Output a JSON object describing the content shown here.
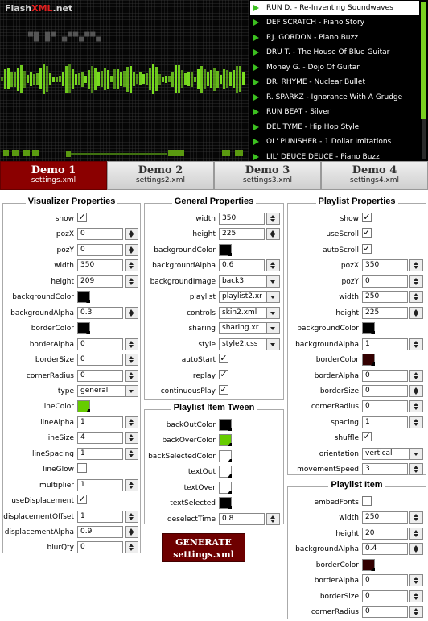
{
  "brand": {
    "part1": "Flash",
    "part2": "XML",
    "part3": ".net"
  },
  "player": {
    "ghost_text": "▀█ █▀ ▄▀▀▄▀▀▄",
    "accent": "#7be020",
    "highlight": "#3cc020"
  },
  "playlist": [
    {
      "label": "RUN D. - Re-Inventing Soundwaves",
      "selected": true
    },
    {
      "label": "DEF SCRATCH - Piano Story"
    },
    {
      "label": "P.J. GORDON - Piano Buzz"
    },
    {
      "label": "DRU T. - The House Of Blue Guitar"
    },
    {
      "label": "Money G. - Dojo Of Guitar"
    },
    {
      "label": "DR. RHYME - Nuclear Bullet"
    },
    {
      "label": "R. SPARKZ - Ignorance With A Grudge"
    },
    {
      "label": "RUN BEAT - Silver"
    },
    {
      "label": "DEL TYME - Hip Hop Style"
    },
    {
      "label": "OL' PUNISHER - 1 Dollar Imitations"
    },
    {
      "label": "LIL' DEUCE DEUCE - Piano Buzz"
    }
  ],
  "tabs": [
    {
      "title": "Demo 1",
      "file": "settings.xml",
      "active": true
    },
    {
      "title": "Demo 2",
      "file": "settings2.xml"
    },
    {
      "title": "Demo 3",
      "file": "settings3.xml"
    },
    {
      "title": "Demo 4",
      "file": "settings4.xml"
    }
  ],
  "visualizer": {
    "title": "Visualizer Properties",
    "rows": [
      {
        "label": "show",
        "type": "check",
        "checked": true
      },
      {
        "label": "pozX",
        "type": "num",
        "value": "0"
      },
      {
        "label": "pozY",
        "type": "num",
        "value": "0"
      },
      {
        "label": "width",
        "type": "num",
        "value": "350"
      },
      {
        "label": "height",
        "type": "num",
        "value": "209"
      },
      {
        "label": "backgroundColor",
        "type": "color",
        "color": "#000000"
      },
      {
        "label": "backgroundAlpha",
        "type": "num",
        "value": "0.3"
      },
      {
        "label": "borderColor",
        "type": "color",
        "color": "#000000"
      },
      {
        "label": "borderAlpha",
        "type": "num",
        "value": "0"
      },
      {
        "label": "borderSize",
        "type": "num",
        "value": "0"
      },
      {
        "label": "cornerRadius",
        "type": "num",
        "value": "0"
      },
      {
        "label": "type",
        "type": "select",
        "value": "general"
      },
      {
        "label": "lineColor",
        "type": "color",
        "color": "#66cc00"
      },
      {
        "label": "lineAlpha",
        "type": "num",
        "value": "1"
      },
      {
        "label": "lineSize",
        "type": "num",
        "value": "4"
      },
      {
        "label": "lineSpacing",
        "type": "num",
        "value": "1"
      },
      {
        "label": "lineGlow",
        "type": "check",
        "checked": false
      },
      {
        "label": "multiplier",
        "type": "num",
        "value": "1"
      },
      {
        "label": "useDisplacement",
        "type": "check",
        "checked": true
      },
      {
        "label": "displacementOffset",
        "type": "num",
        "value": "1"
      },
      {
        "label": "displacementAlpha",
        "type": "num",
        "value": "0.9"
      },
      {
        "label": "blurQty",
        "type": "num",
        "value": "0"
      }
    ]
  },
  "general": {
    "title": "General Properties",
    "rows": [
      {
        "label": "width",
        "type": "num",
        "value": "350"
      },
      {
        "label": "height",
        "type": "num",
        "value": "225"
      },
      {
        "label": "backgroundColor",
        "type": "color",
        "color": "#000000"
      },
      {
        "label": "backgroundAlpha",
        "type": "num",
        "value": "0.6"
      },
      {
        "label": "backgroundImage",
        "type": "select",
        "value": "back3"
      },
      {
        "label": "playlist",
        "type": "select",
        "value": "playlist2.xr"
      },
      {
        "label": "controls",
        "type": "select",
        "value": "skin2.xml"
      },
      {
        "label": "sharing",
        "type": "select",
        "value": "sharing.xr"
      },
      {
        "label": "style",
        "type": "select",
        "value": "style2.css"
      },
      {
        "label": "autoStart",
        "type": "check",
        "checked": true
      },
      {
        "label": "replay",
        "type": "check",
        "checked": true
      },
      {
        "label": "continuousPlay",
        "type": "check",
        "checked": true
      }
    ]
  },
  "tween": {
    "title": "Playlist Item Tween",
    "rows": [
      {
        "label": "backOutColor",
        "type": "color",
        "color": "#000000"
      },
      {
        "label": "backOverColor",
        "type": "color",
        "color": "#66cc00"
      },
      {
        "label": "backSelectedColor",
        "type": "color",
        "color": "#ffffff"
      },
      {
        "label": "textOut",
        "type": "color",
        "color": "#ffffff"
      },
      {
        "label": "textOver",
        "type": "color",
        "color": "#ffffff"
      },
      {
        "label": "textSelected",
        "type": "color",
        "color": "#000000"
      },
      {
        "label": "deselectTime",
        "type": "num",
        "value": "0.8"
      }
    ]
  },
  "playlistProps": {
    "title": "Playlist Properties",
    "rows": [
      {
        "label": "show",
        "type": "check",
        "checked": true
      },
      {
        "label": "useScroll",
        "type": "check",
        "checked": true
      },
      {
        "label": "autoScroll",
        "type": "check",
        "checked": true
      },
      {
        "label": "pozX",
        "type": "num",
        "value": "350"
      },
      {
        "label": "pozY",
        "type": "num",
        "value": "0"
      },
      {
        "label": "width",
        "type": "num",
        "value": "250"
      },
      {
        "label": "height",
        "type": "num",
        "value": "225"
      },
      {
        "label": "backgroundColor",
        "type": "color",
        "color": "#000000"
      },
      {
        "label": "backgroundAlpha",
        "type": "num",
        "value": "1"
      },
      {
        "label": "borderColor",
        "type": "color",
        "color": "#330000"
      },
      {
        "label": "borderAlpha",
        "type": "num",
        "value": "0"
      },
      {
        "label": "borderSize",
        "type": "num",
        "value": "0"
      },
      {
        "label": "cornerRadius",
        "type": "num",
        "value": "0"
      },
      {
        "label": "spacing",
        "type": "num",
        "value": "1"
      },
      {
        "label": "shuffle",
        "type": "check",
        "checked": true
      },
      {
        "label": "orientation",
        "type": "select",
        "value": "vertical"
      },
      {
        "label": "movementSpeed",
        "type": "num",
        "value": "3"
      }
    ]
  },
  "playlistItem": {
    "title": "Playlist Item",
    "rows": [
      {
        "label": "embedFonts",
        "type": "check",
        "checked": false
      },
      {
        "label": "width",
        "type": "num",
        "value": "250"
      },
      {
        "label": "height",
        "type": "num",
        "value": "20"
      },
      {
        "label": "backgroundAlpha",
        "type": "num",
        "value": "0.4"
      },
      {
        "label": "borderColor",
        "type": "color",
        "color": "#330000"
      },
      {
        "label": "borderAlpha",
        "type": "num",
        "value": "0"
      },
      {
        "label": "borderSize",
        "type": "num",
        "value": "0"
      },
      {
        "label": "cornerRadius",
        "type": "num",
        "value": "0"
      }
    ]
  },
  "generate": {
    "line1": "GENERATE",
    "line2": "settings.xml"
  }
}
